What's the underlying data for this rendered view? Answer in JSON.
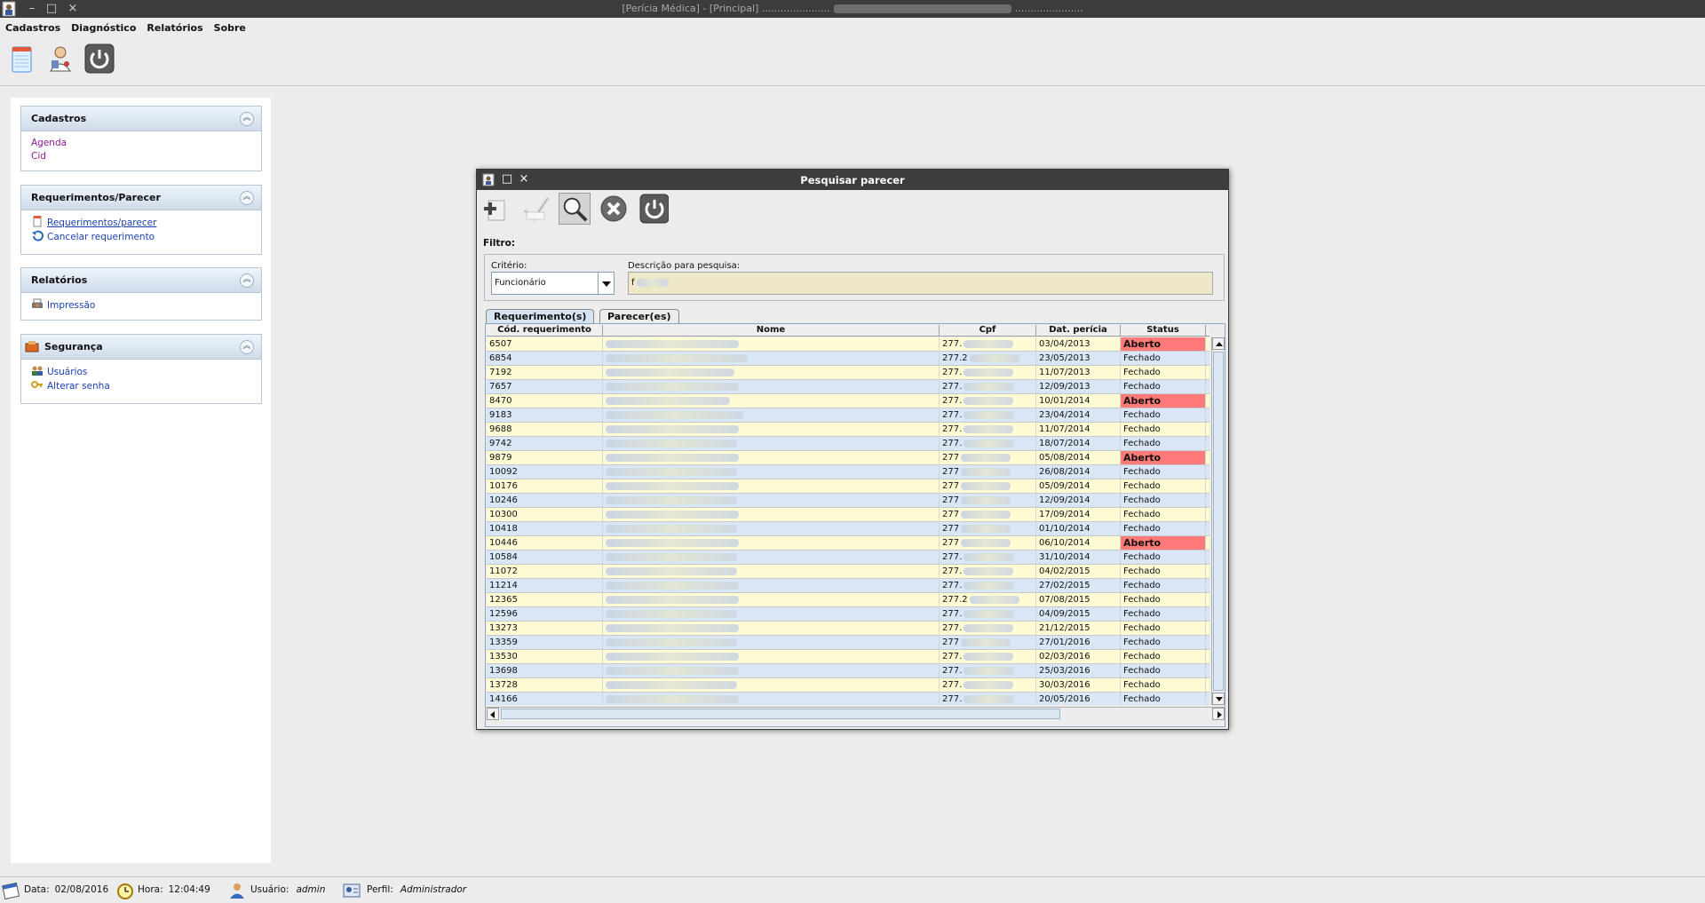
{
  "window": {
    "title_left": "[Perícia Médica] - [Principal] ......................",
    "title_right": "......................",
    "buttons": [
      "–",
      "□",
      "×"
    ]
  },
  "menu": [
    "Cadastros",
    "Diagnóstico",
    "Relatórios",
    "Sobre"
  ],
  "toolbar": {
    "icons": [
      "notepad-icon",
      "doctor-icon",
      "power-icon"
    ]
  },
  "sidebar": {
    "panels": [
      {
        "title": "Cadastros",
        "items": [
          "Agenda",
          "Cid"
        ]
      },
      {
        "title": "Requerimentos/Parecer",
        "items": [
          "Requerimentos/parecer",
          "Cancelar requerimento"
        ]
      },
      {
        "title": "Relatórios",
        "items": [
          "Impressão"
        ]
      },
      {
        "title": "Segurança",
        "items": [
          "Usuários",
          "Alterar senha"
        ]
      }
    ]
  },
  "dialog": {
    "title": "Pesquisar parecer",
    "filter_label": "Filtro:",
    "criterio_label": "Critério:",
    "criterio_value": "Funcionário",
    "descricao_label": "Descrição para pesquisa:",
    "descricao_value": "f",
    "tabs": [
      "Requerimento(s)",
      "Parecer(es)"
    ],
    "columns": [
      "Cód. requerimento",
      "Nome",
      "Cpf",
      "Dat. perícia",
      "Status"
    ],
    "rows": [
      {
        "cod": "6507",
        "cpf": "277.",
        "data": "03/04/2013",
        "status": "Aberto"
      },
      {
        "cod": "6854",
        "cpf": "277.2",
        "data": "23/05/2013",
        "status": "Fechado"
      },
      {
        "cod": "7192",
        "cpf": "277.",
        "data": "11/07/2013",
        "status": "Fechado"
      },
      {
        "cod": "7657",
        "cpf": "277.",
        "data": "12/09/2013",
        "status": "Fechado"
      },
      {
        "cod": "8470",
        "cpf": "277.",
        "data": "10/01/2014",
        "status": "Aberto"
      },
      {
        "cod": "9183",
        "cpf": "277.",
        "data": "23/04/2014",
        "status": "Fechado"
      },
      {
        "cod": "9688",
        "cpf": "277.",
        "data": "11/07/2014",
        "status": "Fechado"
      },
      {
        "cod": "9742",
        "cpf": "277.",
        "data": "18/07/2014",
        "status": "Fechado"
      },
      {
        "cod": "9879",
        "cpf": "277",
        "data": "05/08/2014",
        "status": "Aberto"
      },
      {
        "cod": "10092",
        "cpf": "277",
        "data": "26/08/2014",
        "status": "Fechado"
      },
      {
        "cod": "10176",
        "cpf": "277",
        "data": "05/09/2014",
        "status": "Fechado"
      },
      {
        "cod": "10246",
        "cpf": "277",
        "data": "12/09/2014",
        "status": "Fechado"
      },
      {
        "cod": "10300",
        "cpf": "277",
        "data": "17/09/2014",
        "status": "Fechado"
      },
      {
        "cod": "10418",
        "cpf": "277",
        "data": "01/10/2014",
        "status": "Fechado"
      },
      {
        "cod": "10446",
        "cpf": "277",
        "data": "06/10/2014",
        "status": "Aberto"
      },
      {
        "cod": "10584",
        "cpf": "277.",
        "data": "31/10/2014",
        "status": "Fechado"
      },
      {
        "cod": "11072",
        "cpf": "277.",
        "data": "04/02/2015",
        "status": "Fechado"
      },
      {
        "cod": "11214",
        "cpf": "277.",
        "data": "27/02/2015",
        "status": "Fechado"
      },
      {
        "cod": "12365",
        "cpf": "277.2",
        "data": "07/08/2015",
        "status": "Fechado"
      },
      {
        "cod": "12596",
        "cpf": "277.",
        "data": "04/09/2015",
        "status": "Fechado"
      },
      {
        "cod": "13273",
        "cpf": "277.",
        "data": "21/12/2015",
        "status": "Fechado"
      },
      {
        "cod": "13359",
        "cpf": "277",
        "data": "27/01/2016",
        "status": "Fechado"
      },
      {
        "cod": "13530",
        "cpf": "277.",
        "data": "02/03/2016",
        "status": "Fechado"
      },
      {
        "cod": "13698",
        "cpf": "277.",
        "data": "25/03/2016",
        "status": "Fechado"
      },
      {
        "cod": "13728",
        "cpf": "277.",
        "data": "30/03/2016",
        "status": "Fechado"
      },
      {
        "cod": "14166",
        "cpf": "277.",
        "data": "20/05/2016",
        "status": "Fechado"
      }
    ]
  },
  "statusbar": {
    "data_label": "Data:",
    "data_value": "02/08/2016",
    "hora_label": "Hora:",
    "hora_value": "12:04:49",
    "usuario_label": "Usuário:",
    "usuario_value": "admin",
    "perfil_label": "Perfil:",
    "perfil_value": "Administrador"
  },
  "colors": {
    "aberto": "#ff7a78",
    "row_odd": "#fffcd5",
    "row_even": "#d9e6f5",
    "titlebar": "#3c3c3c",
    "link_purple": "#8a1a92",
    "link_blue": "#1a3fb0"
  }
}
